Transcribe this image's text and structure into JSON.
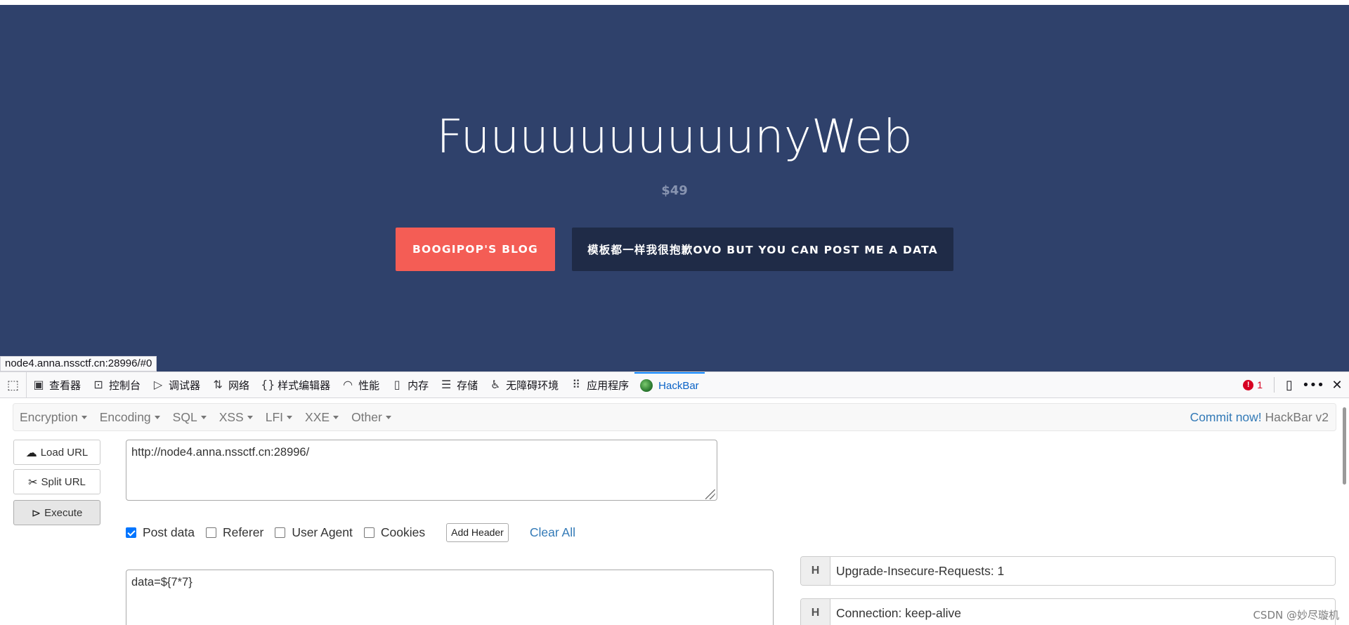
{
  "hero": {
    "title": "FuuuuuuuuuunyWeb",
    "price": "$49",
    "blog_button": "BOOGIPOP'S BLOG",
    "data_button": "模板都一样我很抱歉OVO BUT YOU CAN POST ME A DATA",
    "background_color": "#2f416b",
    "blog_button_color": "#f45d55",
    "data_button_color": "#1f2b47"
  },
  "status_bar": {
    "url": "node4.anna.nssctf.cn:28996/#0"
  },
  "devtools": {
    "tabs": [
      {
        "label": "查看器",
        "icon": "inspector-icon"
      },
      {
        "label": "控制台",
        "icon": "console-icon"
      },
      {
        "label": "调试器",
        "icon": "debugger-icon"
      },
      {
        "label": "网络",
        "icon": "network-icon"
      },
      {
        "label": "样式编辑器",
        "icon": "style-editor-icon"
      },
      {
        "label": "性能",
        "icon": "performance-icon"
      },
      {
        "label": "内存",
        "icon": "memory-icon"
      },
      {
        "label": "存储",
        "icon": "storage-icon"
      },
      {
        "label": "无障碍环境",
        "icon": "accessibility-icon"
      },
      {
        "label": "应用程序",
        "icon": "application-icon"
      },
      {
        "label": "HackBar",
        "icon": "hackbar-icon",
        "active": true
      }
    ],
    "error_count": "1",
    "accent_color": "#0a84ff"
  },
  "hackbar": {
    "menus": [
      "Encryption",
      "Encoding",
      "SQL",
      "XSS",
      "LFI",
      "XXE",
      "Other"
    ],
    "commit_link": "Commit now!",
    "version": "HackBar v2",
    "load_url_label": "Load URL",
    "split_url_label": "Split URL",
    "execute_label": "Execute",
    "url_value": "http://node4.anna.nssctf.cn:28996/",
    "options": [
      {
        "label": "Post data",
        "checked": true
      },
      {
        "label": "Referer",
        "checked": false
      },
      {
        "label": "User Agent",
        "checked": false
      },
      {
        "label": "Cookies",
        "checked": false
      }
    ],
    "add_header_label": "Add Header",
    "clear_all_label": "Clear All",
    "post_data_value": "data=${7*7}",
    "headers": [
      {
        "tag": "H",
        "value": "Upgrade-Insecure-Requests: 1"
      },
      {
        "tag": "H",
        "value": "Connection: keep-alive"
      }
    ]
  },
  "watermark": "CSDN @妙尽璇机"
}
